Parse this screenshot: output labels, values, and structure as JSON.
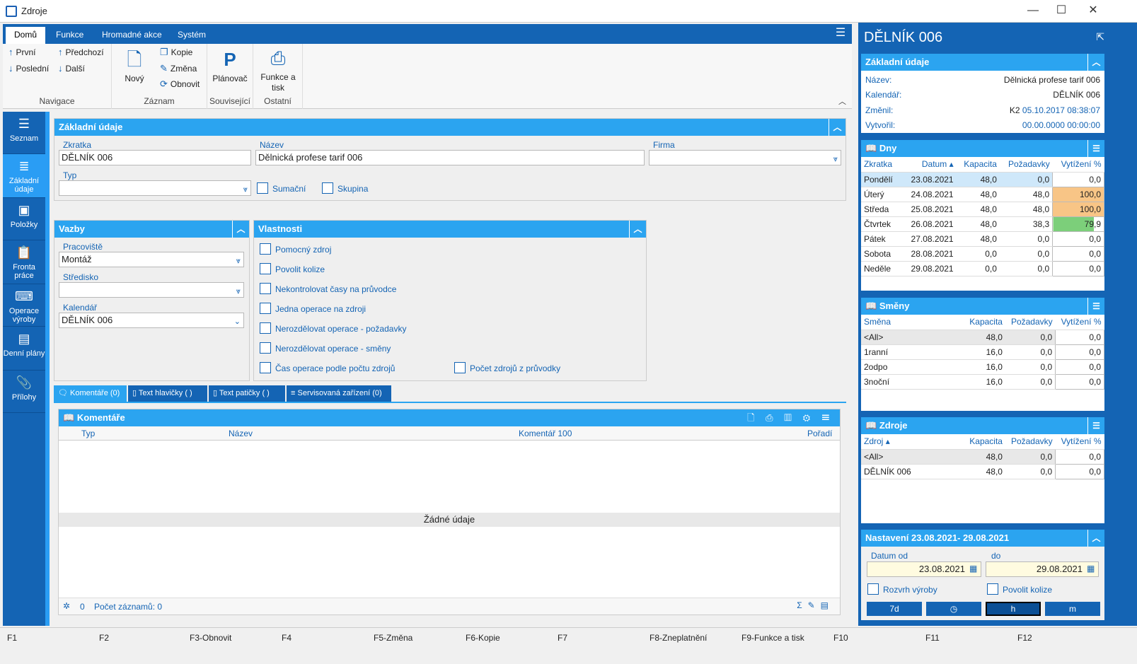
{
  "window": {
    "title": "Zdroje"
  },
  "ribbon": {
    "tabs": [
      "Domů",
      "Funkce",
      "Hromadné akce",
      "Systém"
    ],
    "nav": {
      "first": "První",
      "last": "Poslední",
      "prev": "Předchozí",
      "next": "Další",
      "group": "Navigace"
    },
    "record": {
      "new": "Nový",
      "copy": "Kopie",
      "change": "Změna",
      "refresh": "Obnovit",
      "group": "Záznam"
    },
    "related": {
      "planner": "Plánovač",
      "group": "Související"
    },
    "other": {
      "print": "Funkce a tisk",
      "group": "Ostatní"
    }
  },
  "leftnav": [
    "Seznam",
    "Základní údaje",
    "Položky",
    "Fronta práce",
    "Operace výroby",
    "Denní plány",
    "Přílohy"
  ],
  "basic": {
    "title": "Základní údaje",
    "code_label": "Zkratka",
    "code": "DĚLNÍK 006",
    "name_label": "Název",
    "name": "Dělnická profese tarif 006",
    "firm_label": "Firma",
    "firm": "",
    "type_label": "Typ",
    "type": "",
    "summary": "Sumační",
    "group": "Skupina"
  },
  "links": {
    "title": "Vazby",
    "workplace_label": "Pracoviště",
    "workplace": "Montáž",
    "center_label": "Středisko",
    "center": "",
    "calendar_label": "Kalendář",
    "calendar": "DĚLNÍK 006"
  },
  "props": {
    "title": "Vlastnosti",
    "items": [
      "Pomocný zdroj",
      "Povolit kolize",
      "Nekontrolovat časy na průvodce",
      "Jedna operace na zdroji",
      "Nerozdělovat operace - požadavky",
      "Nerozdělovat operace - směny",
      "Čas operace podle počtu zdrojů"
    ],
    "extra": "Počet zdrojů z průvodky"
  },
  "tabs": [
    "Komentáře (0)",
    "Text hlavičky ( )",
    "Text patičky ( )",
    "Servisovaná zařízení (0)"
  ],
  "comments": {
    "title": "Komentáře",
    "cols": [
      "Typ",
      "Název",
      "Komentář 100",
      "Pořadí"
    ],
    "empty": "Žádné údaje",
    "count_zero": "0",
    "records": "Počet záznamů: 0"
  },
  "right": {
    "title": "DĚLNÍK 006",
    "basic": {
      "title": "Základní údaje",
      "name_label": "Název:",
      "name": "Dělnická profese tarif 006",
      "cal_label": "Kalendář:",
      "cal": "DĚLNÍK 006",
      "changed_label": "Změnil:",
      "changed_user": "K2",
      "changed": "05.10.2017 08:38:07",
      "created_label": "Vytvořil:",
      "created": "00.00.0000 00:00:00"
    },
    "days": {
      "title": "Dny",
      "cols": [
        "Zkratka",
        "Datum",
        "Kapacita",
        "Požadavky",
        "Vytížení %"
      ],
      "rows": [
        [
          "Pondělí",
          "23.08.2021",
          "48,0",
          "0,0",
          "0,0"
        ],
        [
          "Úterý",
          "24.08.2021",
          "48,0",
          "48,0",
          "100,0"
        ],
        [
          "Středa",
          "25.08.2021",
          "48,0",
          "48,0",
          "100,0"
        ],
        [
          "Čtvrtek",
          "26.08.2021",
          "48,0",
          "38,3",
          "79,9"
        ],
        [
          "Pátek",
          "27.08.2021",
          "48,0",
          "0,0",
          "0,0"
        ],
        [
          "Sobota",
          "28.08.2021",
          "0,0",
          "0,0",
          "0,0"
        ],
        [
          "Neděle",
          "29.08.2021",
          "0,0",
          "0,0",
          "0,0"
        ]
      ]
    },
    "shifts": {
      "title": "Směny",
      "cols": [
        "Směna",
        "Kapacita",
        "Požadavky",
        "Vytížení %"
      ],
      "rows": [
        [
          "<All>",
          "48,0",
          "0,0",
          "0,0"
        ],
        [
          "1ranní",
          "16,0",
          "0,0",
          "0,0"
        ],
        [
          "2odpo",
          "16,0",
          "0,0",
          "0,0"
        ],
        [
          "3noční",
          "16,0",
          "0,0",
          "0,0"
        ]
      ]
    },
    "resources": {
      "title": "Zdroje",
      "cols": [
        "Zdroj",
        "Kapacita",
        "Požadavky",
        "Vytížení %"
      ],
      "rows": [
        [
          "<All>",
          "48,0",
          "0,0",
          "0,0"
        ],
        [
          "DĚLNÍK 006",
          "48,0",
          "0,0",
          "0,0"
        ]
      ]
    },
    "settings": {
      "title": "Nastavení 23.08.2021- 29.08.2021",
      "from_label": "Datum od",
      "from": "23.08.2021",
      "to_label": "do",
      "to": "29.08.2021",
      "schedule": "Rozvrh výroby",
      "collisions": "Povolit kolize",
      "buttons": [
        "7d",
        "",
        "h",
        "m"
      ]
    }
  },
  "fkeys": [
    "F1",
    "F2",
    "F3-Obnovit",
    "F4",
    "F5-Změna",
    "F6-Kopie",
    "F7",
    "F8-Zneplatnění",
    "F9-Funkce a tisk",
    "F10",
    "F11",
    "F12"
  ],
  "colors": {
    "brand": "#1464b4",
    "accent": "#2ba4f0",
    "orange": "#f8c586",
    "green": "#7ccf7a"
  }
}
